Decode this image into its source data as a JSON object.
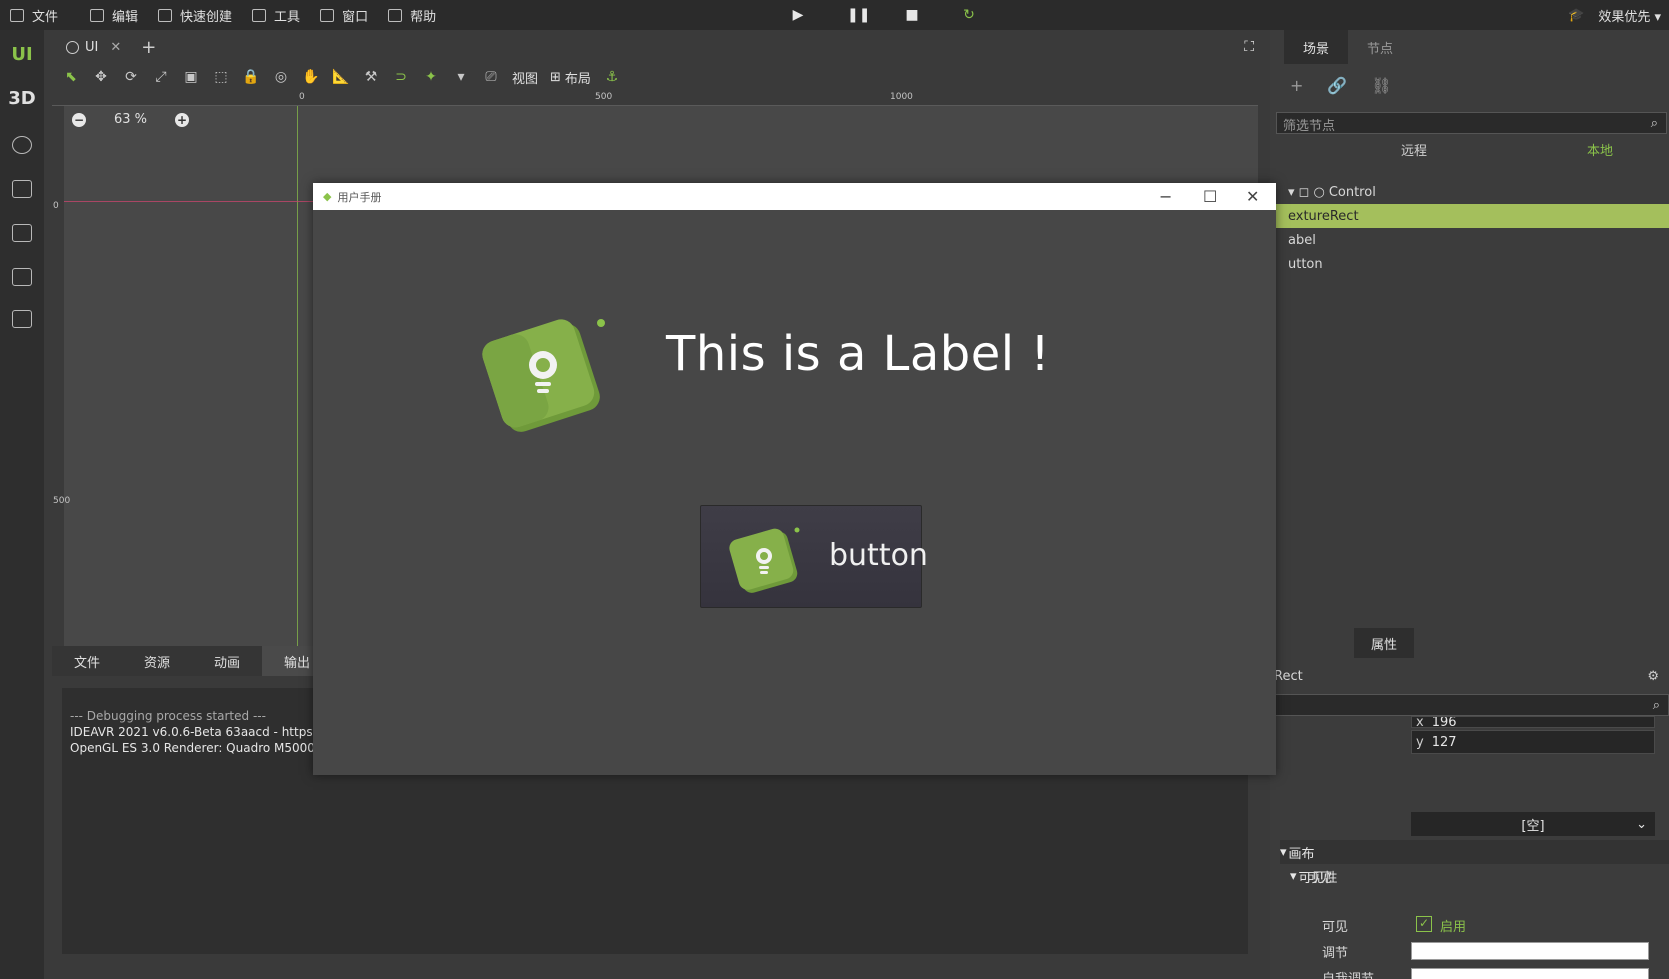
{
  "menubar": {
    "items": [
      "文件",
      "编辑",
      "快速创建",
      "工具",
      "窗口",
      "帮助"
    ],
    "render_quality": "效果优先"
  },
  "play_controls": [
    "play-icon",
    "pause-icon",
    "stop-icon",
    "reload-icon"
  ],
  "left_toolbar": {
    "mode_ui": "UI",
    "mode_3d": "3D"
  },
  "editor": {
    "tab_label": "UI",
    "toolbar": {
      "view_label": "视图",
      "layout_label": "布局"
    },
    "zoom": "63 %",
    "ruler_top": [
      "0",
      "500",
      "1000"
    ],
    "ruler_left": [
      "0",
      "500"
    ]
  },
  "bottom_panel": {
    "tabs": [
      "文件",
      "资源",
      "动画",
      "输出"
    ],
    "active_tab": "输出",
    "console_lines": [
      "--- Debugging process started ---",
      "IDEAVR 2021 v6.0.6-Beta 63aacd - https://ideav",
      "OpenGL ES 3.0 Renderer: Quadro M5000/PCIe/"
    ]
  },
  "right_panel": {
    "tabs": [
      "场景",
      "节点"
    ],
    "active_tab": "场景",
    "filter_placeholder": "筛选节点",
    "remote_label": "远程",
    "local_label": "本地",
    "tree": [
      {
        "label": "Control",
        "selected": false
      },
      {
        "label": "extureRect",
        "selected": true
      },
      {
        "label": "abel",
        "selected": false
      },
      {
        "label": "utton",
        "selected": false
      }
    ],
    "inspector_tab": "属性",
    "inspector_node": "Rect",
    "pos_x": "196",
    "pos_y": "127",
    "empty_select": "[空]",
    "section_canvas": "画布",
    "section_visibility": "可见性",
    "visible_label": "可见",
    "visible_checkbox": "启用",
    "modulate_label": "调节",
    "self_modulate_label": "自我调节"
  },
  "dialog": {
    "title": "用户手册",
    "label_text": "This is a Label !",
    "button_text": "button"
  },
  "colors": {
    "accent_green": "#8bc34a",
    "selection": "#a4bf5c",
    "background": "#3a3a3a"
  }
}
